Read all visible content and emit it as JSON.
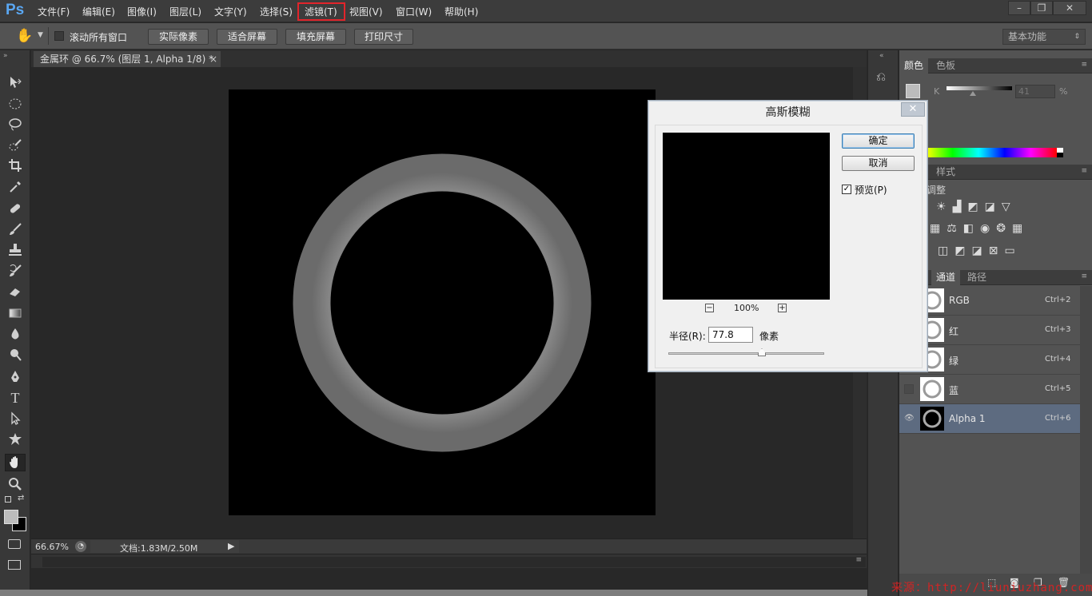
{
  "app": {
    "logo": "Ps"
  },
  "menu": {
    "items": [
      "文件(F)",
      "编辑(E)",
      "图像(I)",
      "图层(L)",
      "文字(Y)",
      "选择(S)",
      "滤镜(T)",
      "视图(V)",
      "窗口(W)",
      "帮助(H)"
    ],
    "highlighted": "滤镜(T)",
    "highlight_color": "#e2242b"
  },
  "window_controls": {
    "minimize": "–",
    "restore": "❐",
    "close": "✕"
  },
  "options_bar": {
    "scroll_all_label": "滚动所有窗口",
    "scroll_all_checked": false,
    "buttons": [
      "实际像素",
      "适合屏幕",
      "填充屏幕",
      "打印尺寸"
    ],
    "workspace": "基本功能"
  },
  "document": {
    "tab_title": "金属环 @ 66.7% (图层 1, Alpha 1/8) *",
    "close_glyph": "×"
  },
  "status": {
    "zoom": "66.67%",
    "doc_info": "文档:1.83M/2.50M"
  },
  "color_panel": {
    "tabs": [
      "颜色",
      "色板"
    ],
    "channel_label": "K",
    "value": "41",
    "unit": "%"
  },
  "adjust_panel": {
    "tab": "样式",
    "title": "调整"
  },
  "channels_panel": {
    "tabs": [
      "通道",
      "路径"
    ],
    "rows": [
      {
        "name": "RGB",
        "shortcut": "Ctrl+2",
        "visible": true
      },
      {
        "name": "红",
        "shortcut": "Ctrl+3",
        "visible": true
      },
      {
        "name": "绿",
        "shortcut": "Ctrl+4",
        "visible": true
      },
      {
        "name": "蓝",
        "shortcut": "Ctrl+5",
        "visible": false
      },
      {
        "name": "Alpha 1",
        "shortcut": "Ctrl+6",
        "visible": true,
        "selected": true
      }
    ]
  },
  "dialog": {
    "title": "高斯模糊",
    "ok": "确定",
    "cancel": "取消",
    "preview_label": "预览(P)",
    "preview_checked": true,
    "zoom_out": "−",
    "zoom_in": "+",
    "zoom": "100%",
    "radius_label": "半径(R):",
    "radius_value": "77.8",
    "radius_unit": "像素"
  },
  "watermark": "来源：http://liuniuzhang.com"
}
